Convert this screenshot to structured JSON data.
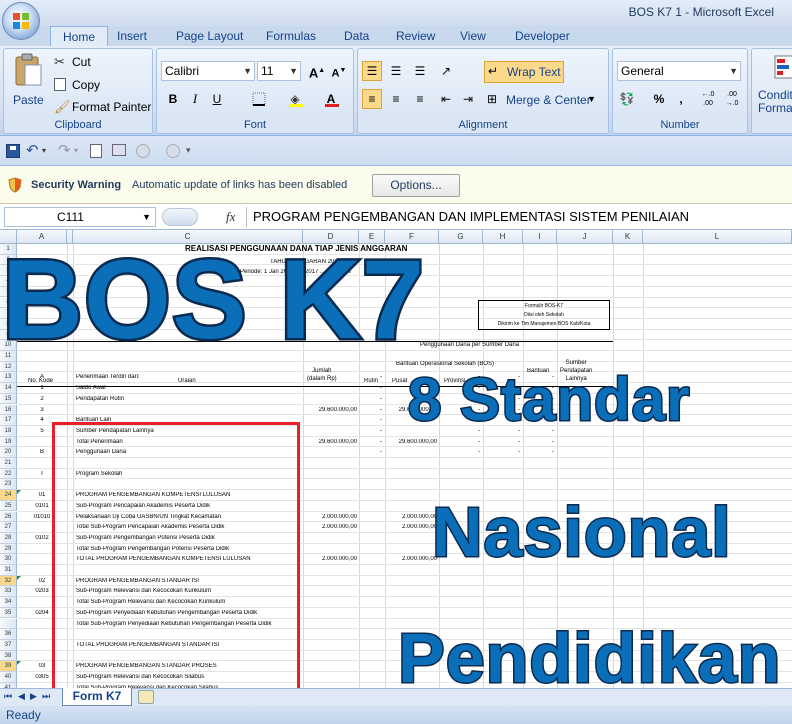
{
  "window": {
    "title": "BOS K7 1 - Microsoft Excel"
  },
  "ribbon_tabs": [
    "Home",
    "Insert",
    "Page Layout",
    "Formulas",
    "Data",
    "Review",
    "View",
    "Developer"
  ],
  "clipboard": {
    "paste": "Paste",
    "cut": "Cut",
    "copy": "Copy",
    "format_painter": "Format Painter",
    "label": "Clipboard"
  },
  "font": {
    "name": "Calibri",
    "size": "11",
    "label": "Font",
    "bold": "B",
    "italic": "I",
    "underline": "U"
  },
  "alignment": {
    "wrap": "Wrap Text",
    "merge": "Merge & Center",
    "label": "Alignment"
  },
  "number": {
    "format": "General",
    "label": "Number",
    "percent": "%",
    "comma": ",",
    "inc": ".0→.00",
    "dec": ".00→.0"
  },
  "styles": {
    "conditional": "Conditi\nFormatt"
  },
  "security": {
    "title": "Security Warning",
    "message": "Automatic update of links has been disabled",
    "options": "Options..."
  },
  "formula_bar": {
    "name_box": "C111",
    "fx": "fx",
    "content": "PROGRAM PENGEMBANGAN DAN IMPLEMENTASI SISTEM PENILAIAN"
  },
  "columns": [
    "A",
    "B",
    "C",
    "D",
    "E",
    "F",
    "G",
    "H",
    "I",
    "J",
    "K",
    "L"
  ],
  "sheet": {
    "title": "REALISASI PENGGUNAAN DANA TIAP JENIS ANGGARAN",
    "tahun": "TAHUN ANGGARAN 2017",
    "periode": "Periode: 1 Jan 2017 s.d 2017 ... 2017 ... k",
    "form_box": [
      "Formulir BOS-K7",
      "Diisi oleh Sekolah",
      "Dikirim ke Tim Manajemen BOS Kab/Kota"
    ],
    "hdr_no": "No. Kode",
    "hdr_uraian": "Uraian",
    "hdr_jumlah": "Jumlah\n(dalam Rp)",
    "hdr_rutin": "Rutin",
    "hdr_sumber": "Penggunaan Dana per Sumber Dana",
    "hdr_bos": "Bantuan Operasional Sekolah (BOS)",
    "hdr_pusat": "Pusat",
    "hdr_prov": "Provinsi",
    "hdr_bantuan": "Bantuan",
    "hdr_lain": "Sumber\nPendapatan\nLainnya",
    "rows": [
      {
        "r": "1",
        "a": "",
        "c": ""
      },
      {
        "r": "2",
        "a": "",
        "c": ""
      },
      {
        "r": "3",
        "a": "",
        "c": ""
      },
      {
        "r": "4",
        "a": "",
        "c": ""
      },
      {
        "r": "5",
        "a": "",
        "c": ""
      },
      {
        "r": "6",
        "a": "",
        "c": ""
      },
      {
        "r": "7",
        "a": "",
        "c": ""
      },
      {
        "r": "8",
        "a": "",
        "c": ""
      },
      {
        "r": "9",
        "a": "",
        "c": ""
      },
      {
        "r": "10",
        "a": "",
        "c": ""
      },
      {
        "r": "11",
        "a": "",
        "c": ""
      },
      {
        "r": "12",
        "a": "",
        "c": ""
      },
      {
        "r": "13",
        "a": "A",
        "c": "Penerimaan Terdiri dari:"
      },
      {
        "r": "14",
        "a": "1",
        "c": "Saldo Awal"
      },
      {
        "r": "15",
        "a": "2",
        "c": "Pendapatan Rutin"
      },
      {
        "r": "16",
        "a": "3",
        "c": "",
        "d": "29.600.000,00",
        "f": "29.600.000,00"
      },
      {
        "r": "17",
        "a": "4",
        "c": "Bantuan Lain"
      },
      {
        "r": "18",
        "a": "5",
        "c": "Sumber Pendapatan Lainnya"
      },
      {
        "r": "19",
        "a": "",
        "c": "Total Penerimaan",
        "d": "29.600.000,00",
        "f": "29.600.000,00"
      },
      {
        "r": "20",
        "a": "B",
        "c": "Penggunaan Dana"
      },
      {
        "r": "21",
        "a": "",
        "c": ""
      },
      {
        "r": "22",
        "a": "I",
        "c": "Program Sekolah"
      },
      {
        "r": "23",
        "a": "",
        "c": ""
      },
      {
        "r": "24",
        "a": "01",
        "c": "PROGRAM PENGEMBANGAN KOMPETENSI LULUSAN",
        "sel": true
      },
      {
        "r": "25",
        "a": "0101",
        "c": "Sub-Program Pencapaian Akademis Peserta Didik"
      },
      {
        "r": "26",
        "a": "01010",
        "c": "Pelaksanaan Uji Coba UASBN/UN Tingkat Kecamatan",
        "d": "2.000.000,00",
        "f": "2.000.000,00"
      },
      {
        "r": "27",
        "a": "",
        "c": "Total Sub-Program Pencapaian Akademis Peserta Didik",
        "d": "2.000.000,00",
        "f": "2.000.000,00"
      },
      {
        "r": "28",
        "a": "0102",
        "c": "Sub-Program Pengembangan Potensi Peserta Didik"
      },
      {
        "r": "29",
        "a": "",
        "c": "Total Sub-Program Pengembangan Potensi Peserta Didik"
      },
      {
        "r": "30",
        "a": "",
        "c": "TOTAL PROGRAM PENGEMBANGAN KOMPETENSI LULUSAN",
        "d": "2.000.000,00",
        "f": "2.000.000,00"
      },
      {
        "r": "31",
        "a": "",
        "c": ""
      },
      {
        "r": "32",
        "a": "02",
        "c": "PROGRAM PENGEMBANGAN STANDAR ISI",
        "sel": true
      },
      {
        "r": "33",
        "a": "0203",
        "c": "Sub-Program Relevansi dan Kecocokan Kurikulum"
      },
      {
        "r": "34",
        "a": "",
        "c": "Total Sub-Program Relevansi dan Kecocokan Kurikulum"
      },
      {
        "r": "35",
        "a": "0204",
        "c": "Sub-Program Penyediaan Kebutuhan Pengembangan Peserta Didik"
      },
      {
        "r": "",
        "a": "",
        "c": "Total Sub-Program Penyediaan Kebutuhan Pengembangan Peserta Didik"
      },
      {
        "r": "36",
        "a": "",
        "c": ""
      },
      {
        "r": "37",
        "a": "",
        "c": "TOTAL PROGRAM PENGEMBANGAN STANDAR ISI"
      },
      {
        "r": "38",
        "a": "",
        "c": ""
      },
      {
        "r": "39",
        "a": "03",
        "c": "PROGRAM PENGEMBANGAN STANDAR PROSES",
        "sel": true
      },
      {
        "r": "40",
        "a": "0305",
        "c": "Sub-Program Relevansi dan Kecocokan Silabus"
      },
      {
        "r": "41",
        "a": "",
        "c": "Total Sub-Program Relevansi dan Kecocokan Silabus"
      }
    ]
  },
  "dash": "-",
  "overlay": {
    "line1": "BOS K7",
    "line2": "8 Standar",
    "line3": "Nasional",
    "line4": "Pendidikan"
  },
  "sheet_tab": "Form K7",
  "status": "Ready",
  "colors": {
    "accent": "#0a6fb8",
    "outline": "#0b2a4f",
    "red_box": "#e8202a"
  }
}
